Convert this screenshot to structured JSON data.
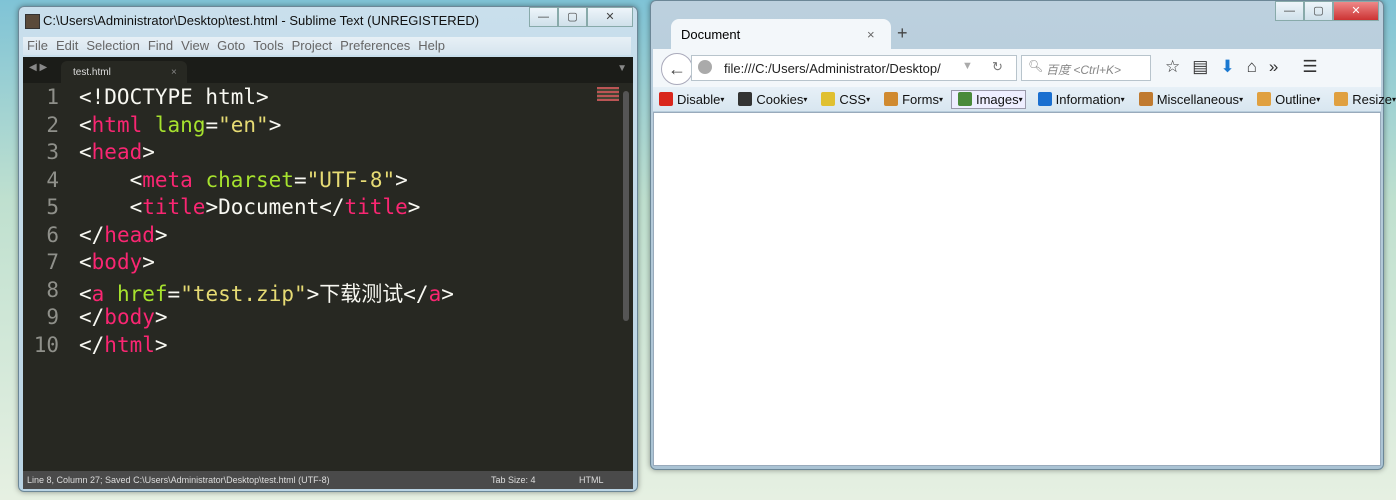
{
  "sublime": {
    "title": "C:\\Users\\Administrator\\Desktop\\test.html - Sublime Text (UNREGISTERED)",
    "menu": [
      "File",
      "Edit",
      "Selection",
      "Find",
      "View",
      "Goto",
      "Tools",
      "Project",
      "Preferences",
      "Help"
    ],
    "tab": {
      "label": "test.html",
      "close": "×"
    },
    "code": [
      [
        [
          "t-txt",
          "<!DOCTYPE html>"
        ]
      ],
      [
        [
          "t-txt",
          "<"
        ],
        [
          "t-tag",
          "html"
        ],
        [
          "t-txt",
          " "
        ],
        [
          "t-attr",
          "lang"
        ],
        [
          "t-txt",
          "="
        ],
        [
          "t-str",
          "\"en\""
        ],
        [
          "t-txt",
          ">"
        ]
      ],
      [
        [
          "t-txt",
          "<"
        ],
        [
          "t-tag",
          "head"
        ],
        [
          "t-txt",
          ">"
        ]
      ],
      [
        [
          "t-txt",
          "    <"
        ],
        [
          "t-tag",
          "meta"
        ],
        [
          "t-txt",
          " "
        ],
        [
          "t-attr",
          "charset"
        ],
        [
          "t-txt",
          "="
        ],
        [
          "t-str",
          "\"UTF-8\""
        ],
        [
          "t-txt",
          ">"
        ]
      ],
      [
        [
          "t-txt",
          "    <"
        ],
        [
          "t-tag",
          "title"
        ],
        [
          "t-txt",
          ">Document</"
        ],
        [
          "t-tag",
          "title"
        ],
        [
          "t-txt",
          ">"
        ]
      ],
      [
        [
          "t-txt",
          "</"
        ],
        [
          "t-tag",
          "head"
        ],
        [
          "t-txt",
          ">"
        ]
      ],
      [
        [
          "t-txt",
          "<"
        ],
        [
          "t-tag",
          "body"
        ],
        [
          "t-txt",
          ">"
        ]
      ],
      [
        [
          "t-txt",
          "<"
        ],
        [
          "t-tag",
          "a"
        ],
        [
          "t-txt",
          " "
        ],
        [
          "t-attr",
          "href"
        ],
        [
          "t-txt",
          "="
        ],
        [
          "t-str",
          "\"test.zip\""
        ],
        [
          "t-txt",
          ">下载测试</"
        ],
        [
          "t-tag",
          "a"
        ],
        [
          "t-txt",
          ">"
        ]
      ],
      [
        [
          "t-txt",
          "</"
        ],
        [
          "t-tag",
          "body"
        ],
        [
          "t-txt",
          ">"
        ]
      ],
      [
        [
          "t-txt",
          "</"
        ],
        [
          "t-tag",
          "html"
        ],
        [
          "t-txt",
          ">"
        ]
      ]
    ],
    "status": {
      "left": "Line 8, Column 27; Saved C:\\Users\\Administrator\\Desktop\\test.html (UTF-8)",
      "tab_size": "Tab Size: 4",
      "syntax": "HTML"
    }
  },
  "firefox": {
    "tab": {
      "label": "Document",
      "close": "×",
      "new": "+"
    },
    "url": "file:///C:/Users/Administrator/Desktop/",
    "search_placeholder": "百度 <Ctrl+K>",
    "webdev": [
      {
        "label": "Disable",
        "color": "#d9261c"
      },
      {
        "label": "Cookies",
        "color": "#333333"
      },
      {
        "label": "CSS",
        "color": "#e0c030"
      },
      {
        "label": "Forms",
        "color": "#d08a30"
      },
      {
        "label": "Images",
        "color": "#4a8a3a",
        "selected": true
      },
      {
        "label": "Information",
        "color": "#1a6fd0"
      },
      {
        "label": "Miscellaneous",
        "color": "#c07a30"
      },
      {
        "label": "Outline",
        "color": "#e0a040"
      },
      {
        "label": "Resize",
        "color": "#e0a040"
      }
    ]
  }
}
